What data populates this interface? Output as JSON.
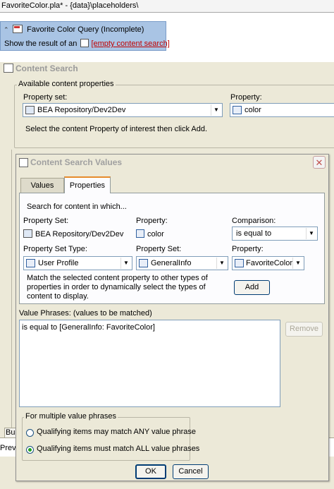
{
  "editor": {
    "tab_title": "FavoriteColor.pla* - {data}\\placeholders\\"
  },
  "query": {
    "title": "Favorite Color Query (Incomplete)",
    "text_prefix": "Show the result of an",
    "link": "[empty content search]"
  },
  "content_search": {
    "section_title": "Content Search",
    "group_legend": "Available content properties",
    "property_set_label": "Property set:",
    "property_set_value": "BEA Repository/Dev2Dev",
    "property_label": "Property:",
    "property_value": "color",
    "instruction": "Select the content Property of interest then click Add."
  },
  "dialog": {
    "title": "Content Search Values",
    "close_glyph": "✕",
    "tabs": [
      {
        "label": "Values",
        "active": false
      },
      {
        "label": "Properties",
        "active": true
      }
    ],
    "search_for": "Search for content in which...",
    "col_property_set": "Property Set:",
    "col_property": "Property:",
    "col_comparison": "Comparison:",
    "property_set_value": "BEA Repository/Dev2Dev",
    "property_value": "color",
    "comparison_value": "is equal to",
    "property_set_type_label": "Property Set Type:",
    "property_set_label": "Property Set:",
    "property_label2": "Property:",
    "property_set_type_value": "User Profile",
    "property_set_value2": "GeneralInfo",
    "property_value2": "FavoriteColor",
    "match_text": "Match the selected content property to other types of properties in order to dynamically select the types of content to display.",
    "add_button": "Add",
    "value_phrases_label": "Value Phrases:  (values to be matched)",
    "value_phrase": "is equal to [GeneralInfo: FavoriteColor]",
    "remove_button": "Remove",
    "multiple_legend": "For multiple value phrases",
    "radio_any": "Qualifying items may match ANY value phrase",
    "radio_all": "Qualifying items must match ALL value phrases",
    "radio_selected": "all",
    "ok_button": "OK",
    "cancel_button": "Cancel"
  },
  "background_fragments": {
    "bu": "Bu",
    "prev": "Prev"
  },
  "colors": {
    "query_panel": "#a9c4e4",
    "link_red": "#c00000",
    "tab_accent": "#e68b2c",
    "dialog_bg": "#ece9d8"
  }
}
